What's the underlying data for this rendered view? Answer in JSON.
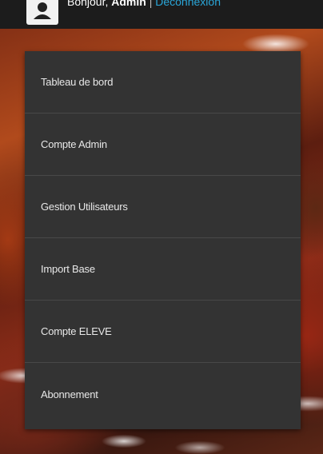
{
  "header": {
    "greeting": "Bonjour,",
    "user": "Admin",
    "separator": "|",
    "logout": "Déconnexion"
  },
  "menu": {
    "items": [
      {
        "label": "Tableau de bord"
      },
      {
        "label": "Compte Admin"
      },
      {
        "label": "Gestion Utilisateurs"
      },
      {
        "label": "Import Base"
      },
      {
        "label": "Compte ELEVE"
      },
      {
        "label": "Abonnement"
      }
    ]
  },
  "colors": {
    "menu_background": "#333333",
    "top_bar": "#1c1c1c",
    "link": "#2aa6d8"
  },
  "icons": {
    "avatar": "user-avatar-icon"
  }
}
